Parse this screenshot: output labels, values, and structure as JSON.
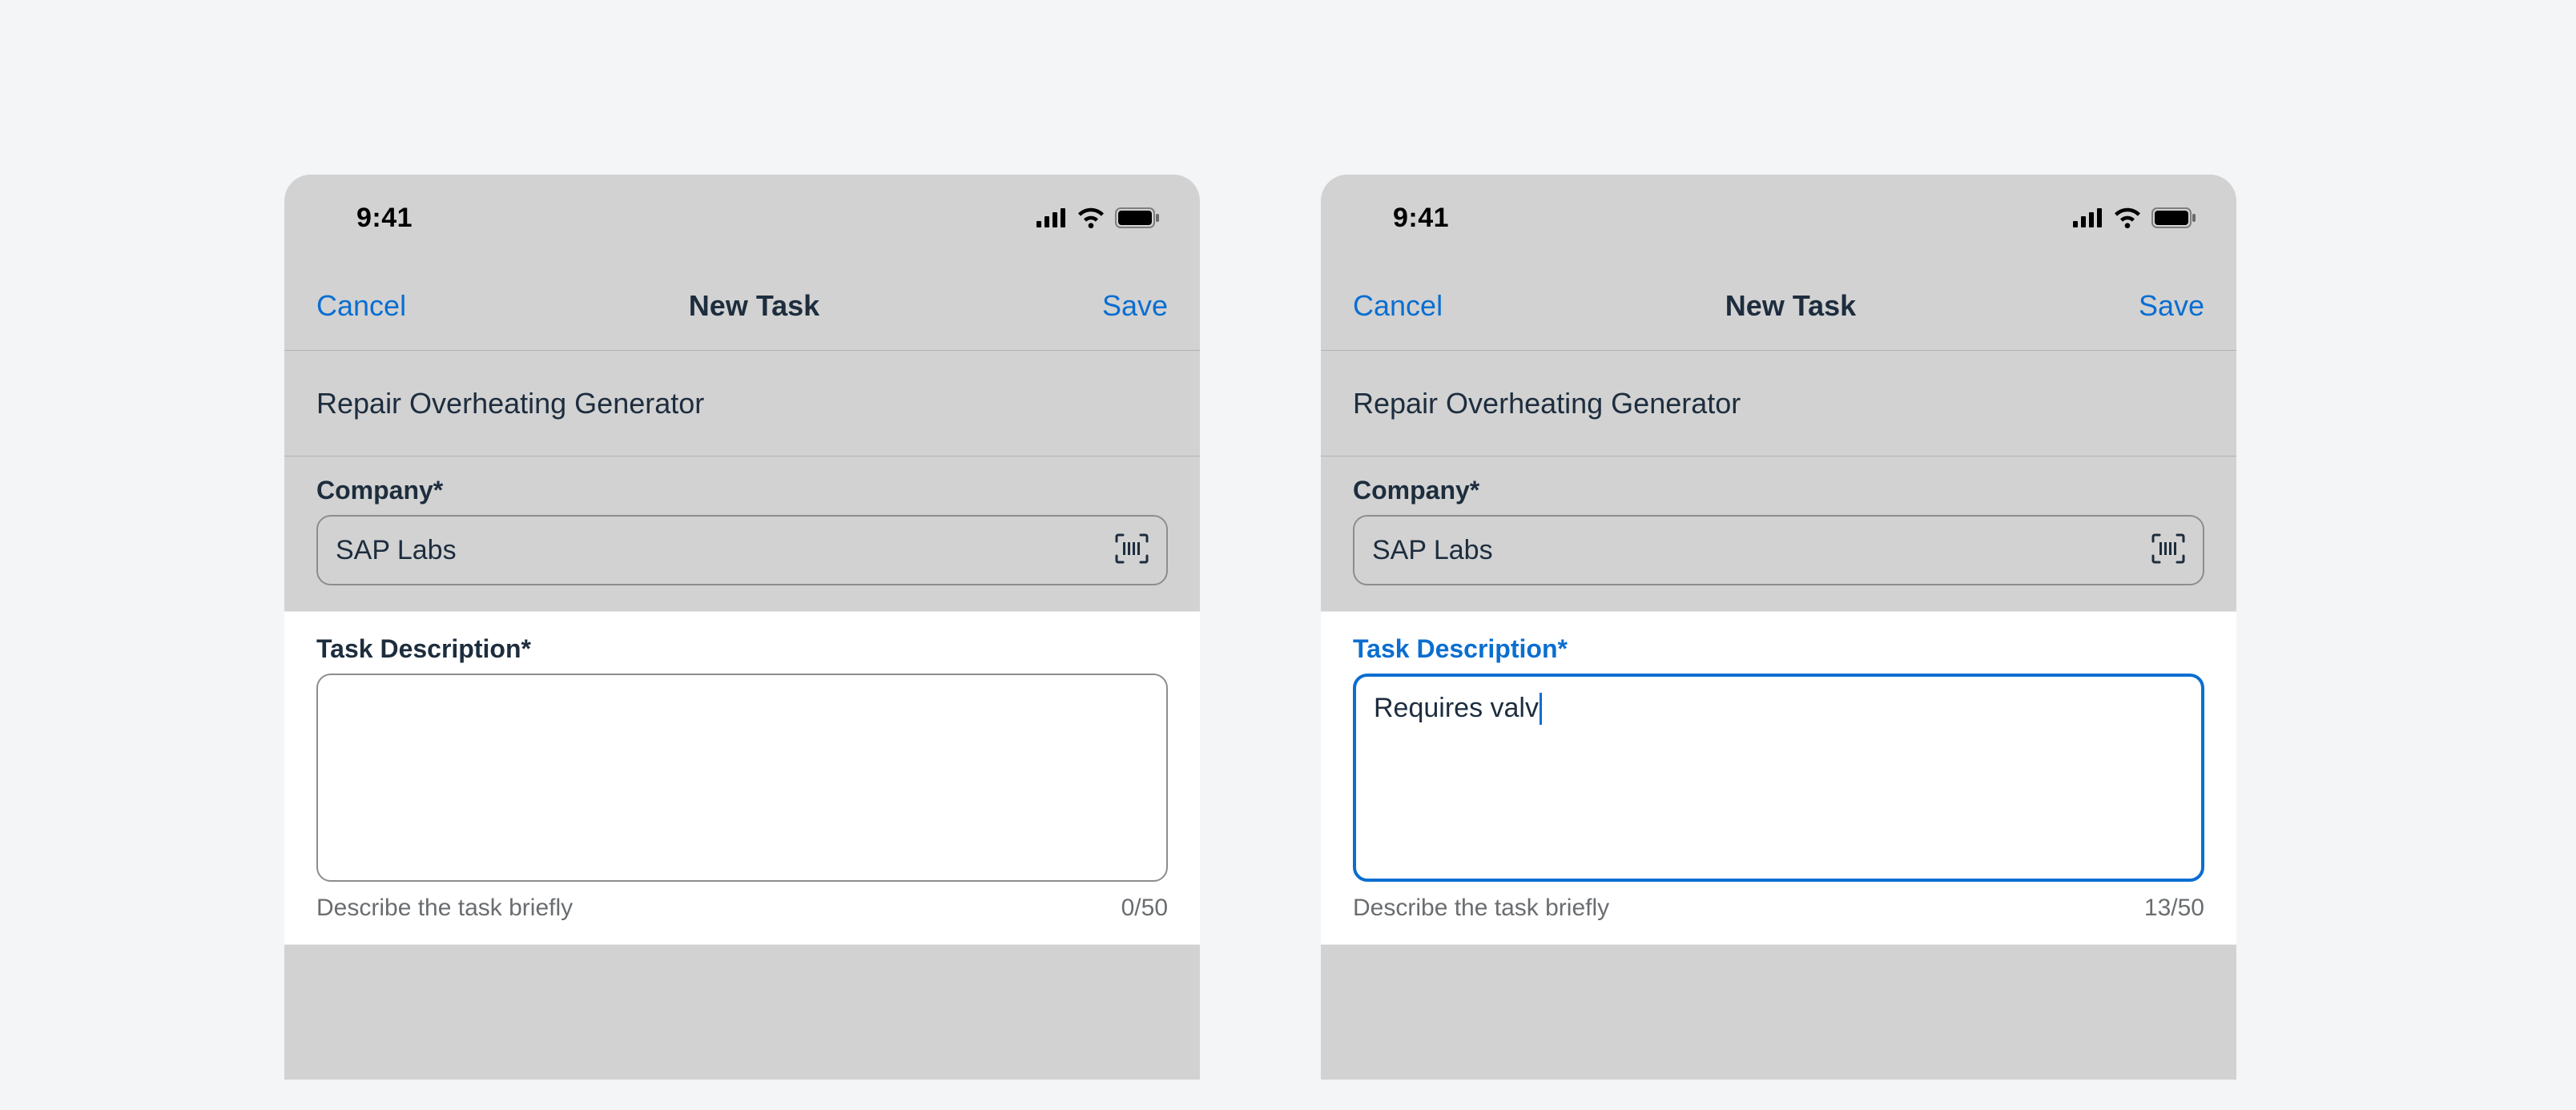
{
  "status": {
    "time": "9:41"
  },
  "nav": {
    "cancel_label": "Cancel",
    "title": "New Task",
    "save_label": "Save"
  },
  "section": {
    "title": "Repair Overheating Generator"
  },
  "company": {
    "label": "Company*",
    "value": "SAP Labs"
  },
  "description": {
    "label": "Task Description*",
    "hint": "Describe the task briefly",
    "left": {
      "value": "",
      "counter": "0/50"
    },
    "right": {
      "value": "Requires valv",
      "counter": "13/50"
    }
  }
}
